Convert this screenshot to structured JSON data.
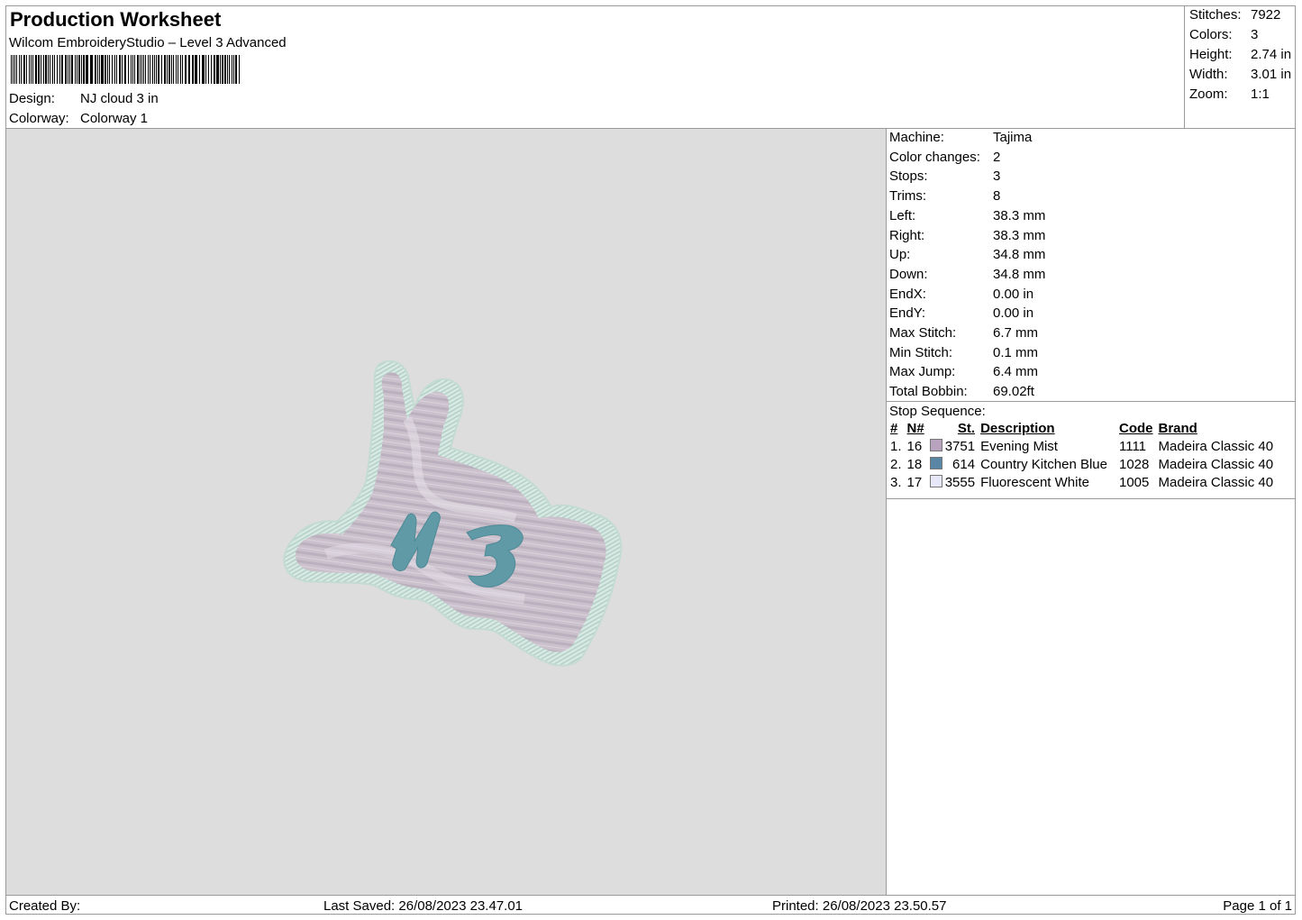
{
  "header": {
    "title": "Production Worksheet",
    "subtitle": "Wilcom EmbroideryStudio – Level 3 Advanced",
    "design_label": "Design:",
    "design_value": "NJ cloud 3 in",
    "colorway_label": "Colorway:",
    "colorway_value": "Colorway 1"
  },
  "summary": [
    {
      "label": "Stitches:",
      "value": "7922"
    },
    {
      "label": "Colors:",
      "value": "3"
    },
    {
      "label": "Height:",
      "value": "2.74 in"
    },
    {
      "label": "Width:",
      "value": "3.01 in"
    },
    {
      "label": "Zoom:",
      "value": "1:1"
    }
  ],
  "machine_info": [
    {
      "label": "Machine:",
      "value": "Tajima"
    },
    {
      "label": "Color changes:",
      "value": "2"
    },
    {
      "label": "Stops:",
      "value": "3"
    },
    {
      "label": "Trims:",
      "value": "8"
    },
    {
      "label": "Left:",
      "value": "38.3 mm"
    },
    {
      "label": "Right:",
      "value": "38.3 mm"
    },
    {
      "label": "Up:",
      "value": "34.8 mm"
    },
    {
      "label": "Down:",
      "value": "34.8 mm"
    },
    {
      "label": "EndX:",
      "value": "0.00 in"
    },
    {
      "label": "EndY:",
      "value": "0.00 in"
    },
    {
      "label": "Max Stitch:",
      "value": "6.7 mm"
    },
    {
      "label": "Min Stitch:",
      "value": "0.1 mm"
    },
    {
      "label": "Max Jump:",
      "value": "6.4 mm"
    },
    {
      "label": "Total Bobbin:",
      "value": "69.02ft"
    }
  ],
  "stop_sequence": {
    "heading": "Stop Sequence:",
    "columns": [
      "#",
      "N#",
      "St.",
      "Description",
      "Code",
      "Brand"
    ],
    "rows": [
      {
        "idx": "1.",
        "n": "16",
        "color": "#b7a3bd",
        "st": "3751",
        "desc": "Evening Mist",
        "code": "1111",
        "brand": "Madeira Classic 40"
      },
      {
        "idx": "2.",
        "n": "18",
        "color": "#5a86a6",
        "st": "614",
        "desc": "Country Kitchen Blue",
        "code": "1028",
        "brand": "Madeira Classic 40"
      },
      {
        "idx": "3.",
        "n": "17",
        "color": "#e6e8f8",
        "st": "3555",
        "desc": "Fluorescent White",
        "code": "1005",
        "brand": "Madeira Classic 40"
      }
    ]
  },
  "footer": {
    "created_by": "Created By:",
    "last_saved": "Last Saved: 26/08/2023 23.47.01",
    "printed": "Printed: 26/08/2023 23.50.57",
    "page": "Page 1 of 1"
  },
  "colors": {
    "canvas": "#dddddd",
    "fill": "#c9bfca",
    "border": "#cde3dc",
    "letters": "#5f9aa6"
  }
}
